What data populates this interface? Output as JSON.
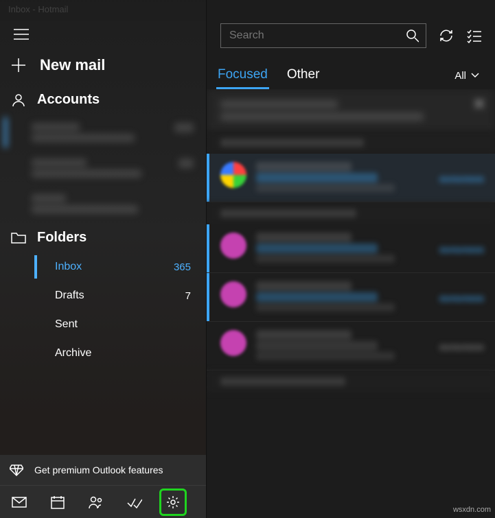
{
  "window": {
    "title": "Inbox - Hotmail"
  },
  "sidebar": {
    "new_mail": "New mail",
    "accounts_label": "Accounts",
    "accounts": [
      {
        "name": "Hotmail",
        "email": "redacted@hotmail.com",
        "count": "365"
      },
      {
        "name": "Hotmail 2",
        "email": "redactedsecond@hotm...",
        "count": "29"
      },
      {
        "name": "Yahoo",
        "email": "redacted@yahoo.co...",
        "count": ""
      }
    ],
    "folders_label": "Folders",
    "folders": [
      {
        "name": "Inbox",
        "count": "365",
        "selected": true
      },
      {
        "name": "Drafts",
        "count": "7",
        "selected": false
      },
      {
        "name": "Sent",
        "count": "",
        "selected": false
      },
      {
        "name": "Archive",
        "count": "",
        "selected": false
      }
    ],
    "premium": "Get premium Outlook features"
  },
  "toolbar": {
    "search_placeholder": "Search"
  },
  "tabs": {
    "focused": "Focused",
    "other": "Other",
    "filter": "All"
  },
  "watermark": "wsxdn.com"
}
